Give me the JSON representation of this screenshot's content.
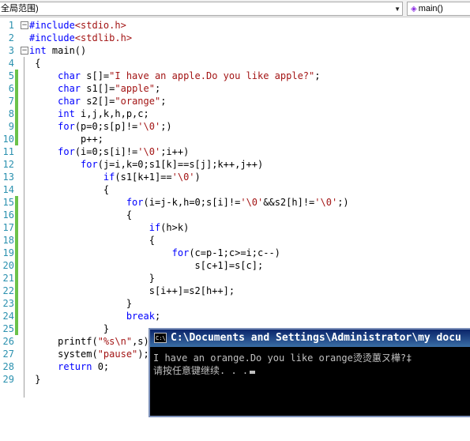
{
  "navbar": {
    "scope_combo": "全局范围)",
    "func_combo": "main()"
  },
  "line_numbers": [
    "1",
    "2",
    "3",
    "4",
    "5",
    "6",
    "7",
    "8",
    "9",
    "10",
    "11",
    "12",
    "13",
    "14",
    "15",
    "16",
    "17",
    "18",
    "19",
    "20",
    "21",
    "22",
    "23",
    "24",
    "25",
    "26",
    "27",
    "28",
    "29"
  ],
  "code": [
    [
      [
        "pp",
        "#include"
      ],
      [
        "str",
        "<stdio.h>"
      ]
    ],
    [
      [
        "pp",
        "#include"
      ],
      [
        "str",
        "<stdlib.h>"
      ]
    ],
    [
      [
        "kw",
        "int"
      ],
      [
        "t",
        " main()"
      ]
    ],
    [
      [
        "t",
        " {"
      ]
    ],
    [
      [
        "t",
        "     "
      ],
      [
        "kw",
        "char"
      ],
      [
        "t",
        " s[]="
      ],
      [
        "str",
        "\"I have an apple.Do you like apple?\""
      ],
      [
        "t",
        ";"
      ]
    ],
    [
      [
        "t",
        "     "
      ],
      [
        "kw",
        "char"
      ],
      [
        "t",
        " s1[]="
      ],
      [
        "str",
        "\"apple\""
      ],
      [
        "t",
        ";"
      ]
    ],
    [
      [
        "t",
        "     "
      ],
      [
        "kw",
        "char"
      ],
      [
        "t",
        " s2[]="
      ],
      [
        "str",
        "\"orange\""
      ],
      [
        "t",
        ";"
      ]
    ],
    [
      [
        "t",
        "     "
      ],
      [
        "kw",
        "int"
      ],
      [
        "t",
        " i,j,k,h,p,c;"
      ]
    ],
    [
      [
        "t",
        "     "
      ],
      [
        "kw",
        "for"
      ],
      [
        "t",
        "(p=0;s[p]!="
      ],
      [
        "str",
        "'\\0'"
      ],
      [
        "t",
        ";)"
      ]
    ],
    [
      [
        "t",
        "         p++;"
      ]
    ],
    [
      [
        "t",
        "     "
      ],
      [
        "kw",
        "for"
      ],
      [
        "t",
        "(i=0;s[i]!="
      ],
      [
        "str",
        "'\\0'"
      ],
      [
        "t",
        ";i++)"
      ]
    ],
    [
      [
        "t",
        "         "
      ],
      [
        "kw",
        "for"
      ],
      [
        "t",
        "(j=i,k=0;s1[k]==s[j];k++,j++)"
      ]
    ],
    [
      [
        "t",
        "             "
      ],
      [
        "kw",
        "if"
      ],
      [
        "t",
        "(s1[k+1]=="
      ],
      [
        "str",
        "'\\0'"
      ],
      [
        "t",
        ")"
      ]
    ],
    [
      [
        "t",
        "             {"
      ]
    ],
    [
      [
        "t",
        "                 "
      ],
      [
        "kw",
        "for"
      ],
      [
        "t",
        "(i=j-k,h=0;s[i]!="
      ],
      [
        "str",
        "'\\0'"
      ],
      [
        "t",
        "&&s2[h]!="
      ],
      [
        "str",
        "'\\0'"
      ],
      [
        "t",
        ";)"
      ]
    ],
    [
      [
        "t",
        "                 {"
      ]
    ],
    [
      [
        "t",
        "                     "
      ],
      [
        "kw",
        "if"
      ],
      [
        "t",
        "(h>k)"
      ]
    ],
    [
      [
        "t",
        "                     {"
      ]
    ],
    [
      [
        "t",
        "                         "
      ],
      [
        "kw",
        "for"
      ],
      [
        "t",
        "(c=p-1;c>=i;c--)"
      ]
    ],
    [
      [
        "t",
        "                             s[c+1]=s[c];"
      ]
    ],
    [
      [
        "t",
        "                     }"
      ]
    ],
    [
      [
        "t",
        "                     s[i++]=s2[h++];"
      ]
    ],
    [
      [
        "t",
        "                 }"
      ]
    ],
    [
      [
        "t",
        "                 "
      ],
      [
        "kw",
        "break"
      ],
      [
        "t",
        ";"
      ]
    ],
    [
      [
        "t",
        "             }"
      ]
    ],
    [
      [
        "t",
        "     printf("
      ],
      [
        "str",
        "\"%s\\n\""
      ],
      [
        "t",
        ",s);"
      ]
    ],
    [
      [
        "t",
        "     system("
      ],
      [
        "str",
        "\"pause\""
      ],
      [
        "t",
        ");"
      ]
    ],
    [
      [
        "t",
        "     "
      ],
      [
        "kw",
        "return"
      ],
      [
        "t",
        " 0;"
      ]
    ],
    [
      [
        "t",
        " }"
      ]
    ]
  ],
  "changed_lines": [
    5,
    6,
    7,
    8,
    9,
    10,
    15,
    16,
    17,
    18,
    19,
    20,
    21,
    22,
    23,
    24,
    25
  ],
  "console": {
    "title": "C:\\Documents and Settings\\Administrator\\my docu",
    "output_line1": "I have an orange.Do you like orange烫烫蕙ㄡ樺?‡",
    "output_line2": "请按任意键继续. . ."
  },
  "colors": {
    "keyword": "#0000ff",
    "string": "#a31515",
    "line_number": "#2b91af",
    "change_bar": "#6cc24a",
    "console_bg": "#000000",
    "console_title_bg": "#0a246a"
  }
}
